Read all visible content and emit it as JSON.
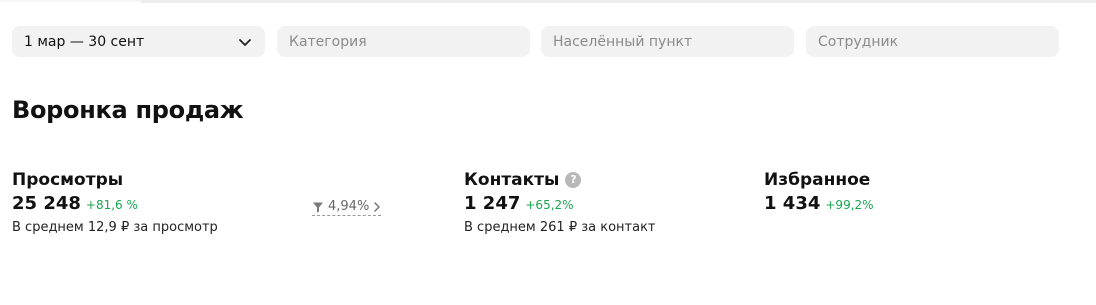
{
  "filters": {
    "date_range": "1 мар — 30 сент",
    "category_placeholder": "Категория",
    "locality_placeholder": "Населённый пункт",
    "employee_placeholder": "Сотрудник"
  },
  "section": {
    "title": "Воронка продаж"
  },
  "funnel": {
    "views": {
      "label": "Просмотры",
      "value": "25 248",
      "change": "+81,6 %",
      "note": "В среднем 12,9 ₽ за просмотр"
    },
    "conversion": {
      "value": "4,94%"
    },
    "contacts": {
      "label": "Контакты",
      "help": "?",
      "value": "1 247",
      "change": "+65,2%",
      "note": "В среднем 261 ₽ за контакт"
    },
    "favorites": {
      "label": "Избранное",
      "value": "1 434",
      "change": "+99,2%"
    }
  },
  "colors": {
    "positive": "#1aa551",
    "field_bg": "#f2f2f2"
  },
  "icons": [
    "chevron-down-icon",
    "filter-icon",
    "chevron-right-icon",
    "help-icon"
  ]
}
